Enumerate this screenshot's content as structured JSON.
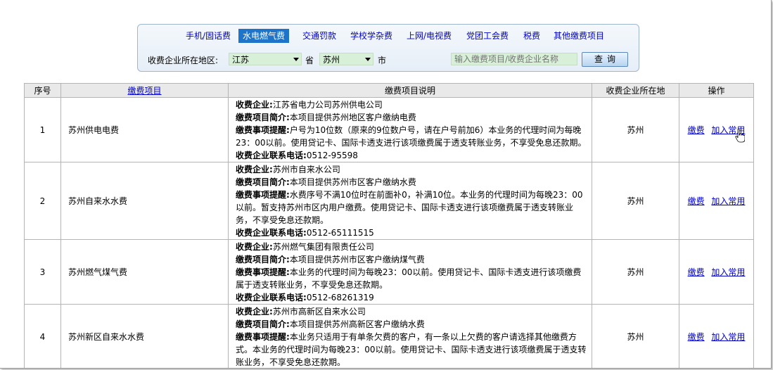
{
  "tabs": [
    {
      "label": "手机/固话费",
      "active": false
    },
    {
      "label": "水电燃气费",
      "active": true
    },
    {
      "label": "交通罚款",
      "active": false
    },
    {
      "label": "学校学杂费",
      "active": false
    },
    {
      "label": "上网/电视费",
      "active": false
    },
    {
      "label": "党团工会费",
      "active": false
    },
    {
      "label": "税费",
      "active": false
    },
    {
      "label": "其他缴费项目",
      "active": false
    }
  ],
  "filter": {
    "region_label": "收费企业所在地区:",
    "province_value": "江苏",
    "province_unit": "省",
    "city_value": "苏州",
    "city_unit": "市",
    "search_placeholder": "输入缴费项目/收费企业名称",
    "search_button": "查询"
  },
  "table": {
    "headers": {
      "no": "序号",
      "item": "缴费项目",
      "desc": "缴费项目说明",
      "region": "收费企业所在地",
      "op": "操作"
    },
    "desc_labels": {
      "company": "收费企业:",
      "intro": "缴费项目简介:",
      "notice": "缴费事项提醒:",
      "phone": "收费企业联系电话:"
    },
    "pay_label": "缴费",
    "fav_label": "加入常用",
    "rows": [
      {
        "no": "1",
        "item": "苏州供电电费",
        "company": "江苏省电力公司苏州供电公司",
        "intro": "本项目提供苏州地区客户缴纳电费",
        "notice": "户号为10位数（原来的9位数户号，请在户号前加6）本业务的代理时间为每晚23：00以前。使用贷记卡、国际卡透支进行该项缴费属于透支转账业务，不享受免息还款期。",
        "phone": "0512-95598",
        "region": "苏州"
      },
      {
        "no": "2",
        "item": "苏州自来水水费",
        "company": "苏州市自来水公司",
        "intro": "本项目提供苏州市区客户缴纳水费",
        "notice": "水费序号不满10位时在前面补0，补满10位。本业务的代理时间为每晚23：00以前。暂支持苏州市区内用户缴费。使用贷记卡、国际卡透支进行该项缴费属于透支转账业务，不享受免息还款期。",
        "phone": "0512-65111515",
        "region": "苏州"
      },
      {
        "no": "3",
        "item": "苏州燃气煤气费",
        "company": "苏州燃气集团有限责任公司",
        "intro": "本项目提供苏州市区客户缴纳煤气费",
        "notice": "本业务的代理时间为每晚23：00以前。使用贷记卡、国际卡透支进行该项缴费属于透支转账业务，不享受免息还款期。",
        "phone": "0512-68261319",
        "region": "苏州"
      },
      {
        "no": "4",
        "item": "苏州新区自来水水费",
        "company": "苏州市高新区自来水公司",
        "intro": "本项目提供苏州高新区客户缴纳水费",
        "notice": "本业务只适用于有单条欠费的客户，有一条以上欠费的客户请选择其他缴费方式。本业务的代理时间为每晚23：00以前。使用贷记卡、国际卡透支进行该项缴费属于透支转账业务，不享受免息还款期。",
        "phone": "",
        "region": "苏州"
      }
    ]
  }
}
